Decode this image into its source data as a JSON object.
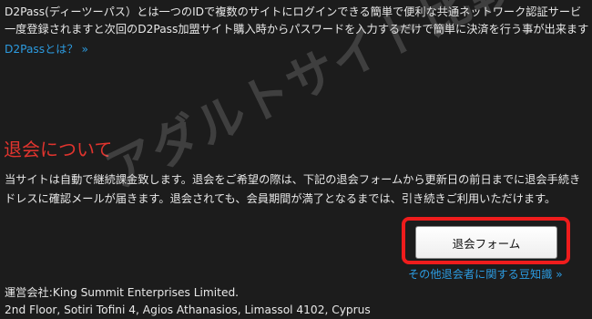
{
  "intro": {
    "line1": "D2Pass(ディーツーパス）とは一つのIDで複数のサイトにログインできる簡単で便利な共通ネットワーク認証サービ",
    "line2": "一度登録されますと次回のD2Pass加盟サイト購入時からパスワードを入力するだけで簡単に決済を行う事が出来ます",
    "link_label": "D2Passとは？ »"
  },
  "withdrawal": {
    "heading": "退会について",
    "paragraph_line1": "当サイトは自動で継続課金致します。退会をご希望の際は、下記の退会フォームから更新日の前日までに退会手続き",
    "paragraph_line2": "ドレスに確認メールが届きます。退会されても、会員期間が満了となるまでは、引き続きご利用いただけます。",
    "button_label": "退会フォーム",
    "knowledge_link": "その他退会者に関する豆知識 »"
  },
  "footer": {
    "company": "運営会社:King Summit Enterprises Limited.",
    "address": "2nd Floor, Sotiri Tofini 4, Agios Athanasios, Limassol 4102, Cyprus"
  },
  "watermark": {
    "text": "アダルトサイト比較部！"
  },
  "colors": {
    "background": "#1c1c1c",
    "text": "#e8e8e8",
    "link": "#2c9be0",
    "heading": "#e0342e",
    "highlight_frame": "#ef1c1c"
  }
}
